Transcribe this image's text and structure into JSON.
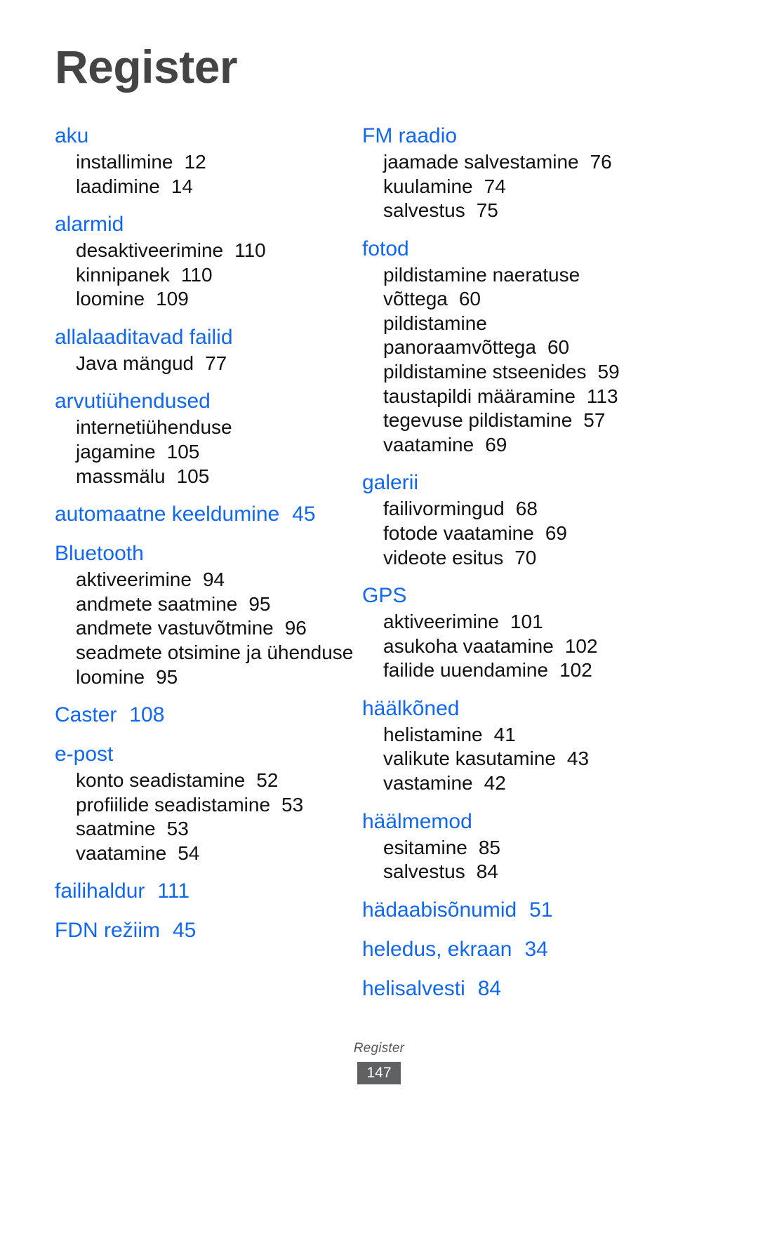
{
  "title": "Register",
  "colors": {
    "heading_blue": "#1168f0",
    "body_black": "#111111",
    "title_gray": "#444444",
    "badge_bg": "#5f6163"
  },
  "footer": {
    "label": "Register",
    "page_number": "147"
  },
  "columns": [
    {
      "id": "left",
      "groups": [
        {
          "heading": "aku",
          "heading_page": "",
          "entries": [
            {
              "text": "installimine",
              "page": "12"
            },
            {
              "text": "laadimine",
              "page": "14"
            }
          ]
        },
        {
          "heading": "alarmid",
          "heading_page": "",
          "entries": [
            {
              "text": "desaktiveerimine",
              "page": "110"
            },
            {
              "text": "kinnipanek",
              "page": "110"
            },
            {
              "text": "loomine",
              "page": "109"
            }
          ]
        },
        {
          "heading": "allalaaditavad failid",
          "heading_page": "",
          "entries": [
            {
              "text": "Java mängud",
              "page": "77"
            }
          ]
        },
        {
          "heading": "arvutiühendused",
          "heading_page": "",
          "entries": [
            {
              "text": "internetiühenduse jagamine",
              "page": "105"
            },
            {
              "text": "massmälu",
              "page": "105"
            }
          ]
        },
        {
          "heading": "automaatne keeldumine",
          "heading_page": "45",
          "entries": []
        },
        {
          "heading": "Bluetooth",
          "heading_page": "",
          "entries": [
            {
              "text": "aktiveerimine",
              "page": "94"
            },
            {
              "text": "andmete saatmine",
              "page": "95"
            },
            {
              "text": "andmete vastuvõtmine",
              "page": "96"
            },
            {
              "text": "seadmete otsimine ja ühenduse loomine",
              "page": "95"
            }
          ]
        },
        {
          "heading": "Caster",
          "heading_page": "108",
          "entries": []
        },
        {
          "heading": "e-post",
          "heading_page": "",
          "entries": [
            {
              "text": "konto seadistamine",
              "page": "52"
            },
            {
              "text": "profiilide seadistamine",
              "page": "53"
            },
            {
              "text": "saatmine",
              "page": "53"
            },
            {
              "text": "vaatamine",
              "page": "54"
            }
          ]
        },
        {
          "heading": "failihaldur",
          "heading_page": "111",
          "entries": []
        },
        {
          "heading": "FDN režiim",
          "heading_page": "45",
          "entries": []
        }
      ]
    },
    {
      "id": "right",
      "groups": [
        {
          "heading": "FM raadio",
          "heading_page": "",
          "entries": [
            {
              "text": "jaamade salvestamine",
              "page": "76"
            },
            {
              "text": "kuulamine",
              "page": "74"
            },
            {
              "text": "salvestus",
              "page": "75"
            }
          ]
        },
        {
          "heading": "fotod",
          "heading_page": "",
          "entries": [
            {
              "text": "pildistamine naeratuse võttega",
              "page": "60"
            },
            {
              "text": "pildistamine panoraamvõttega",
              "page": "60"
            },
            {
              "text": "pildistamine stseenides",
              "page": "59"
            },
            {
              "text": "taustapildi määramine",
              "page": "113"
            },
            {
              "text": "tegevuse pildistamine",
              "page": "57"
            },
            {
              "text": "vaatamine",
              "page": "69"
            }
          ]
        },
        {
          "heading": "galerii",
          "heading_page": "",
          "entries": [
            {
              "text": "failivormingud",
              "page": "68"
            },
            {
              "text": "fotode vaatamine",
              "page": "69"
            },
            {
              "text": "videote esitus",
              "page": "70"
            }
          ]
        },
        {
          "heading": "GPS",
          "heading_page": "",
          "entries": [
            {
              "text": "aktiveerimine",
              "page": "101"
            },
            {
              "text": "asukoha vaatamine",
              "page": "102"
            },
            {
              "text": "failide uuendamine",
              "page": "102"
            }
          ]
        },
        {
          "heading": "häälkõned",
          "heading_page": "",
          "entries": [
            {
              "text": "helistamine",
              "page": "41"
            },
            {
              "text": "valikute kasutamine",
              "page": "43"
            },
            {
              "text": "vastamine",
              "page": "42"
            }
          ]
        },
        {
          "heading": "häälmemod",
          "heading_page": "",
          "entries": [
            {
              "text": "esitamine",
              "page": "85"
            },
            {
              "text": "salvestus",
              "page": "84"
            }
          ]
        },
        {
          "heading": "hädaabisõnumid",
          "heading_page": "51",
          "entries": []
        },
        {
          "heading": "heledus, ekraan",
          "heading_page": "34",
          "entries": []
        },
        {
          "heading": "helisalvesti",
          "heading_page": "84",
          "entries": []
        }
      ]
    }
  ]
}
